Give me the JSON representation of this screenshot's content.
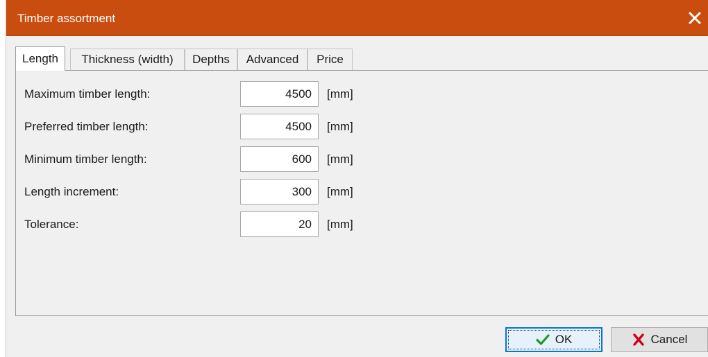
{
  "window": {
    "title": "Timber assortment",
    "accent_color": "#c84d0e"
  },
  "tabs": [
    {
      "label": "Length",
      "active": true
    },
    {
      "label": "Thickness (width)",
      "active": false
    },
    {
      "label": "Depths",
      "active": false
    },
    {
      "label": "Advanced",
      "active": false
    },
    {
      "label": "Price",
      "active": false
    }
  ],
  "fields": [
    {
      "label": "Maximum timber length:",
      "value": "4500",
      "unit": "[mm]"
    },
    {
      "label": "Preferred timber length:",
      "value": "4500",
      "unit": "[mm]"
    },
    {
      "label": "Minimum timber length:",
      "value": "600",
      "unit": "[mm]"
    },
    {
      "label": "Length increment:",
      "value": "300",
      "unit": "[mm]"
    },
    {
      "label": "Tolerance:",
      "value": "20",
      "unit": "[mm]"
    }
  ],
  "buttons": {
    "ok_label": "OK",
    "ok_icon": "checkmark-icon",
    "cancel_label": "Cancel",
    "cancel_icon": "cross-icon"
  },
  "colors": {
    "ok_icon": "#1f9a1f",
    "cancel_icon": "#d0021b"
  }
}
